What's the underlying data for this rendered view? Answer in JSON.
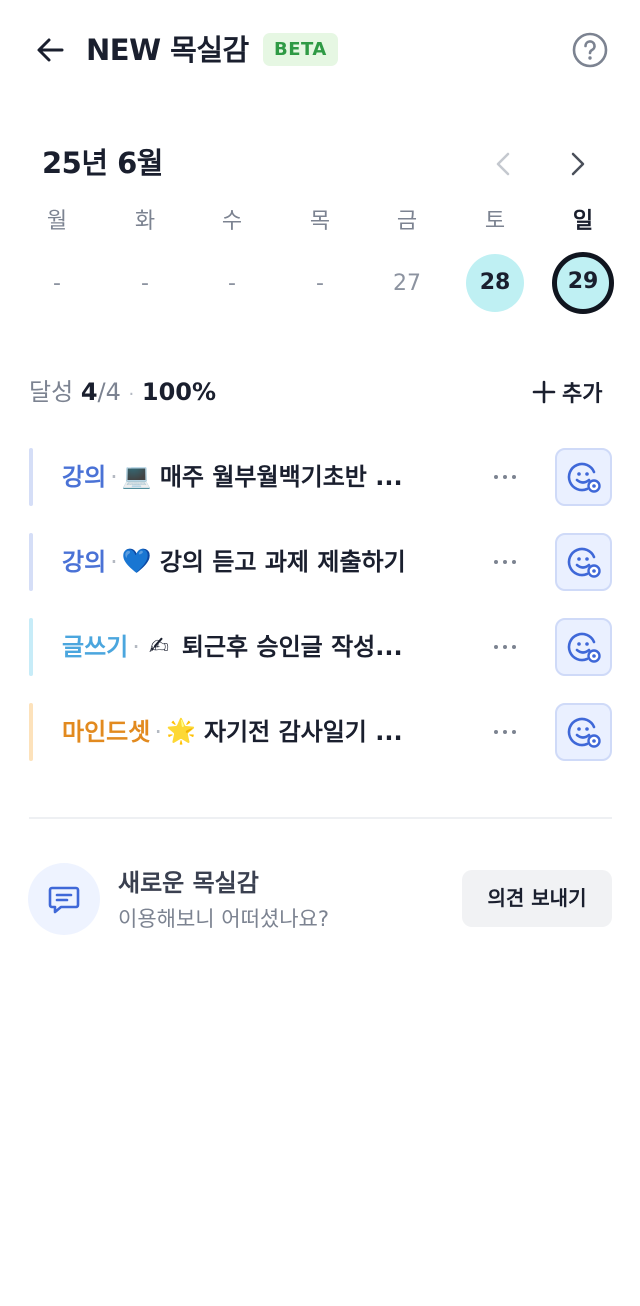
{
  "header": {
    "title": "NEW 목실감",
    "badge": "BETA"
  },
  "calendar": {
    "month_label": "25년 6월",
    "weekdays": [
      "월",
      "화",
      "수",
      "목",
      "금",
      "토",
      "일"
    ],
    "dates": [
      "-",
      "-",
      "-",
      "-",
      "27",
      "28",
      "29"
    ],
    "selected_date": "29"
  },
  "progress": {
    "label": "달성",
    "done": "4",
    "total": "/4",
    "separator": "·",
    "percent": "100%",
    "add_label": "추가"
  },
  "tasks": [
    {
      "category": "강의",
      "category_color": "#4a72d6",
      "bar_color": "#d5def7",
      "separator": "·",
      "emoji": "💻",
      "emoji_icon": "laptop-icon",
      "text": "매주 월부월백기초반 ..."
    },
    {
      "category": "강의",
      "category_color": "#4a72d6",
      "bar_color": "#d5def7",
      "separator": "·",
      "emoji": "💙",
      "emoji_icon": "blue-heart-icon",
      "text": "강의 듣고 과제 제출하기"
    },
    {
      "category": "글쓰기",
      "category_color": "#4ba6de",
      "bar_color": "#c7ecf8",
      "separator": "·",
      "emoji": "✍",
      "emoji_icon": "writing-hand-icon",
      "text": "퇴근후 승인글 작성..."
    },
    {
      "category": "마인드셋",
      "category_color": "#e28a1f",
      "bar_color": "#fde2bb",
      "separator": "·",
      "emoji": "🌟",
      "emoji_icon": "glowing-star-icon",
      "text": "자기전 감사일기 ..."
    }
  ],
  "feedback": {
    "title": "새로운 목실감",
    "subtitle": "이용해보니 어떠셨나요?",
    "button_label": "의견 보내기"
  },
  "colors": {
    "accent_circle": "#bff0f3",
    "beta_bg": "#e6f7e3",
    "beta_text": "#2f9a45",
    "react_bg": "#eaf0ff",
    "react_icon": "#3f68d8"
  }
}
